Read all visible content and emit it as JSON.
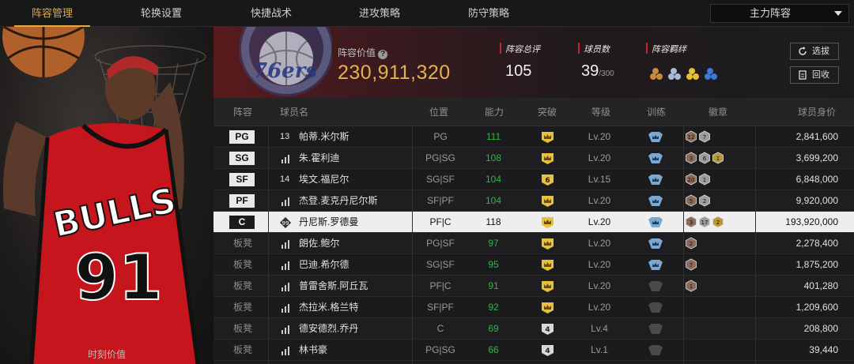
{
  "nav": {
    "tabs": [
      {
        "label": "阵容管理",
        "active": true
      },
      {
        "label": "轮换设置",
        "active": false
      },
      {
        "label": "快捷战术",
        "active": false
      },
      {
        "label": "进攻策略",
        "active": false
      },
      {
        "label": "防守策略",
        "active": false
      }
    ],
    "lineup_select": "主力阵容"
  },
  "left_panel": {
    "caption": "时刻价值",
    "jersey_text": "BULLS",
    "jersey_number": "91"
  },
  "team": {
    "logo_text": "76ers",
    "value_label": "阵容价值",
    "value": "230,911,320",
    "rating_label": "阵容总评",
    "rating": "105",
    "players_label": "球员数",
    "players_count": "39",
    "players_max": "/300",
    "bond_label": "阵容羁绊",
    "buttons": {
      "pick": "选拔",
      "recall": "回收"
    }
  },
  "colors": {
    "accent": "#e6a93a",
    "value_gold": "#e6b04a",
    "ability_green": "#33b24a",
    "team_red": "#c9222a"
  },
  "table": {
    "headers": {
      "lineup": "阵容",
      "name": "球员名",
      "position": "位置",
      "ability": "能力",
      "breakthrough": "突破",
      "level": "等级",
      "training": "训练",
      "badges": "徽章",
      "value": "球员身价"
    },
    "rows": [
      {
        "slot": "PG",
        "num_icon": "13",
        "name": "帕蒂.米尔斯",
        "pos": "PG",
        "ability": "111",
        "breakthrough": "crown",
        "level": "Lv.20",
        "trained": true,
        "badges": [
          "12",
          "7"
        ],
        "value": "2,841,600"
      },
      {
        "slot": "SG",
        "num_icon": "bars",
        "name": "朱.霍利迪",
        "pos": "PG|SG",
        "ability": "108",
        "breakthrough": "crown",
        "level": "Lv.20",
        "trained": true,
        "badges": [
          "3",
          "6",
          "1"
        ],
        "value": "3,699,200"
      },
      {
        "slot": "SF",
        "num_icon": "14",
        "name": "埃文.福尼尔",
        "pos": "SG|SF",
        "ability": "104",
        "breakthrough": "6",
        "level": "Lv.15",
        "trained": true,
        "badges": [
          "20",
          "1"
        ],
        "value": "6,848,000"
      },
      {
        "slot": "PF",
        "num_icon": "bars",
        "name": "杰登.麦克丹尼尔斯",
        "pos": "SF|PF",
        "ability": "104",
        "breakthrough": "crown",
        "level": "Lv.20",
        "trained": true,
        "badges": [
          "5",
          "2"
        ],
        "value": "9,920,000"
      },
      {
        "slot": "C",
        "num_icon": "99",
        "name": "丹尼斯.罗德曼",
        "pos": "PF|C",
        "ability": "118",
        "breakthrough": "crown",
        "level": "Lv.20",
        "trained": true,
        "badges": [
          "3",
          "17",
          "2"
        ],
        "value": "193,920,000",
        "selected": true
      },
      {
        "slot": "板凳",
        "num_icon": "bars",
        "name": "朗佐.鲍尔",
        "pos": "PG|SF",
        "ability": "97",
        "breakthrough": "crown",
        "level": "Lv.20",
        "trained": true,
        "badges": [
          "2"
        ],
        "value": "2,278,400"
      },
      {
        "slot": "板凳",
        "num_icon": "bars",
        "name": "巴迪.希尔德",
        "pos": "SG|SF",
        "ability": "95",
        "breakthrough": "crown",
        "level": "Lv.20",
        "trained": true,
        "badges": [
          "7"
        ],
        "value": "1,875,200"
      },
      {
        "slot": "板凳",
        "num_icon": "bars",
        "name": "普雷舍斯.阿丘瓦",
        "pos": "PF|C",
        "ability": "91",
        "breakthrough": "crown",
        "level": "Lv.20",
        "trained": false,
        "badges": [
          "1"
        ],
        "value": "401,280"
      },
      {
        "slot": "板凳",
        "num_icon": "bars",
        "name": "杰拉米.格兰特",
        "pos": "SF|PF",
        "ability": "92",
        "breakthrough": "crown",
        "level": "Lv.20",
        "trained": false,
        "badges": [],
        "value": "1,209,600"
      },
      {
        "slot": "板凳",
        "num_icon": "bars",
        "name": "德安德烈.乔丹",
        "pos": "C",
        "ability": "69",
        "breakthrough": "4",
        "level": "Lv.4",
        "trained": false,
        "badges": [],
        "value": "208,800"
      },
      {
        "slot": "板凳",
        "num_icon": "bars",
        "name": "林书豪",
        "pos": "PG|SG",
        "ability": "66",
        "breakthrough": "4",
        "level": "Lv.1",
        "trained": false,
        "badges": [],
        "value": "39,440"
      }
    ]
  }
}
